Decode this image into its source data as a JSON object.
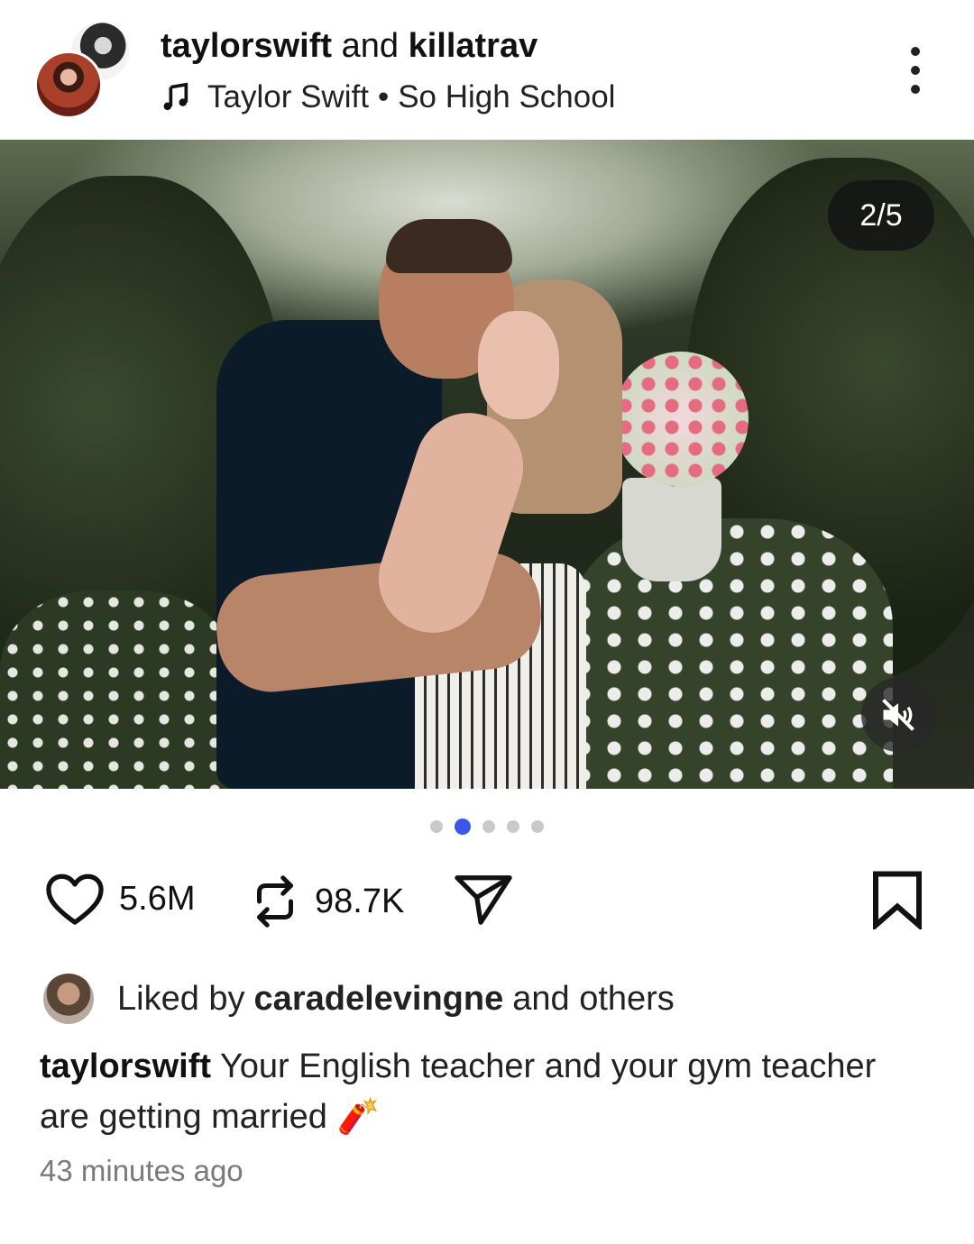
{
  "header": {
    "author": "taylorswift",
    "conjunction": "and",
    "coauthor": "killatrav",
    "music_artist": "Taylor Swift",
    "music_separator": "•",
    "music_song": "So High School",
    "music_icon": "music-note-icon",
    "more_icon": "more-vertical-icon"
  },
  "media": {
    "counter": "2/5",
    "current_index": 2,
    "total": 5,
    "mute_icon": "muted-speaker-icon"
  },
  "actions": {
    "likes": "5.6M",
    "reposts": "98.7K",
    "like_icon": "heart-icon",
    "repost_icon": "repost-icon",
    "share_icon": "send-icon",
    "save_icon": "bookmark-icon"
  },
  "liked_by": {
    "prefix": "Liked by",
    "user": "caradelevingne",
    "suffix": "and others"
  },
  "caption": {
    "user": "taylorswift",
    "text": "Your English teacher and your gym teacher are getting married",
    "emoji": "🧨"
  },
  "timestamp": "43 minutes ago",
  "colors": {
    "accent_dot": "#3b57e8",
    "inactive_dot": "#c9c9c9",
    "timestamp": "#7a7a7a"
  }
}
